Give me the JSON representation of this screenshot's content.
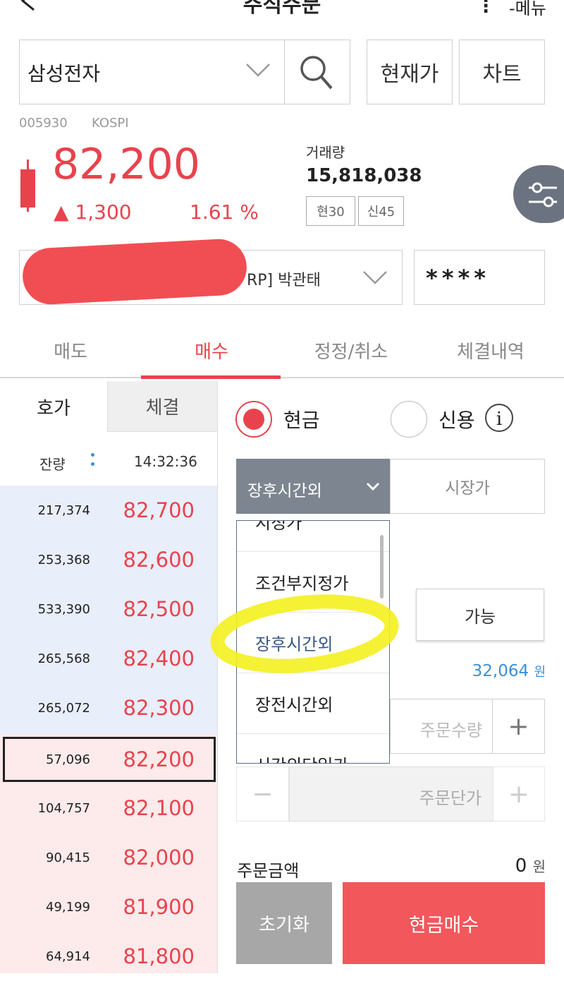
{
  "header": {
    "title": "주식주문",
    "menu_label": "메뉴"
  },
  "stock": {
    "name": "삼성전자",
    "code": "005930",
    "market": "KOSPI",
    "price": "82,200",
    "change": "▲ 1,300",
    "change_pct": "1.61 %",
    "volume_label": "거래량",
    "volume": "15,818,038",
    "tag1": "현30",
    "tag2": "신45"
  },
  "buttons": {
    "current_price": "현재가",
    "chart": "차트",
    "available": "가능",
    "reset": "초기화",
    "cash_buy": "현금매수"
  },
  "account": {
    "visible_text": "RP] 박관태",
    "password": "****"
  },
  "tabs": [
    {
      "label": "매도",
      "active": false
    },
    {
      "label": "매수",
      "active": true
    },
    {
      "label": "정정/취소",
      "active": false
    },
    {
      "label": "체결내역",
      "active": false
    }
  ],
  "orderbook": {
    "tab_quote": "호가",
    "tab_trade": "체결",
    "remaining_label": "잔량",
    "time": "14:32:36",
    "rows": [
      {
        "qty": "217,374",
        "price": "82,700"
      },
      {
        "qty": "253,368",
        "price": "82,600"
      },
      {
        "qty": "533,390",
        "price": "82,500"
      },
      {
        "qty": "265,568",
        "price": "82,400"
      },
      {
        "qty": "265,072",
        "price": "82,300"
      },
      {
        "qty": "57,096",
        "price": "82,200"
      },
      {
        "qty": "104,757",
        "price": "82,100"
      },
      {
        "qty": "90,415",
        "price": "82,000"
      },
      {
        "qty": "49,199",
        "price": "81,900"
      },
      {
        "qty": "64,914",
        "price": "81,800"
      }
    ]
  },
  "order": {
    "radio_cash": "현금",
    "radio_credit": "신용",
    "order_type_selected": "장후시간외",
    "market_price_label": "시장가",
    "dropdown_options": [
      "지정가",
      "조건부지정가",
      "장후시간외",
      "장전시간외",
      "시간외단일가"
    ],
    "available_amount": "32,064",
    "won": "원",
    "qty_placeholder": "주문수량",
    "price_placeholder": "주문단가",
    "amount_label": "주문금액",
    "amount_value": "0",
    "minus": "−",
    "plus": "+"
  },
  "colors": {
    "up_red": "#e8434d",
    "highlight": "#f4ef1e",
    "ask_bg": "#e9eefb",
    "bid_bg": "#fdeaea"
  }
}
